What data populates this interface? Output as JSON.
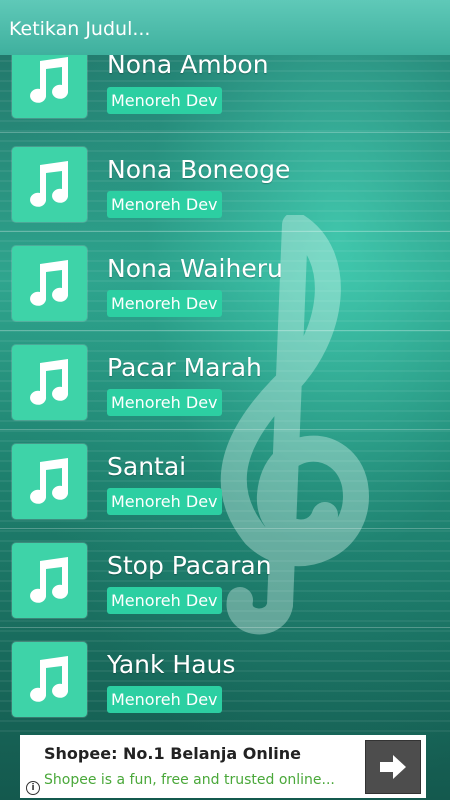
{
  "app": {
    "title": "Ketikan Judul..."
  },
  "songs": [
    {
      "title": "Nona Ambon",
      "artist": "Menoreh Dev"
    },
    {
      "title": "Nona Boneoge",
      "artist": "Menoreh Dev"
    },
    {
      "title": "Nona Waiheru",
      "artist": "Menoreh Dev"
    },
    {
      "title": "Pacar Marah",
      "artist": "Menoreh Dev"
    },
    {
      "title": "Santai",
      "artist": "Menoreh Dev"
    },
    {
      "title": "Stop Pacaran",
      "artist": "Menoreh Dev"
    },
    {
      "title": "Yank Haus",
      "artist": "Menoreh Dev"
    }
  ],
  "ad": {
    "title": "Shopee: No.1 Belanja Online",
    "subtitle": "Shopee is a fun, free and trusted online...",
    "info_icon": "info-icon",
    "cta_icon": "arrow-right-icon"
  },
  "colors": {
    "accent": "#3ed3a8",
    "artist_badge": "#2ccfa2",
    "titlebar": "#4fbdaa"
  }
}
